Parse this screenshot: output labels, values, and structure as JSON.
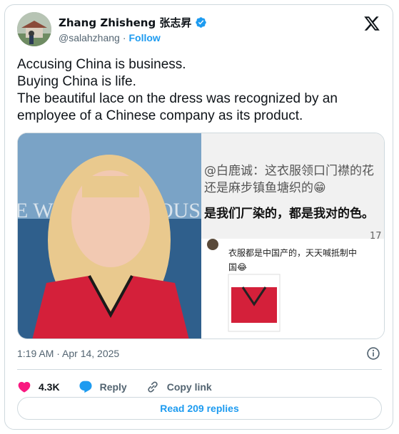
{
  "author": {
    "name": "Zhang Zhisheng 张志昇",
    "handle": "@salahzhang",
    "separator": "·",
    "follow_label": "Follow"
  },
  "tweet": {
    "lines": [
      "Accusing China is business.",
      "Buying China is life.",
      "The beautiful lace on the dress was recognized by an",
      "employee of a Chinese company as its product."
    ]
  },
  "media": {
    "left_background_text": "E W",
    "left_background_text2": "OUS",
    "right_line1": "@白鹿诚：这衣服领口门襟的花",
    "right_line2": "还是麻步镇鱼塘织的😁",
    "right_line3": "是我们厂染的，都是我对的色。",
    "right_like_count": "17",
    "comment_line1": "衣服都是中国产的，天天喊抵制中",
    "comment_line2": "国😂"
  },
  "timestamp": "1:19 AM · Apr 14, 2025",
  "actions": {
    "like_count": "4.3K",
    "reply_label": "Reply",
    "copy_link_label": "Copy link"
  },
  "read_replies_label": "Read 209 replies",
  "colors": {
    "accent": "#1d9bf0",
    "like": "#f91880",
    "border": "#cfd9de",
    "muted": "#536471"
  }
}
